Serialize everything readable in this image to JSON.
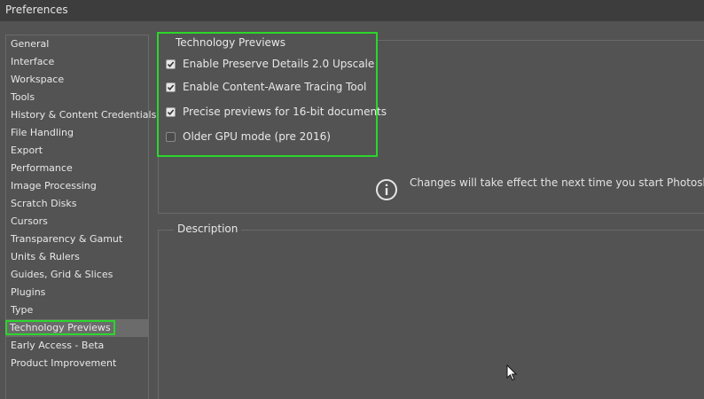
{
  "window": {
    "title": "Preferences"
  },
  "sidebar": {
    "items": [
      {
        "label": "General"
      },
      {
        "label": "Interface"
      },
      {
        "label": "Workspace"
      },
      {
        "label": "Tools"
      },
      {
        "label": "History & Content Credentials"
      },
      {
        "label": "File Handling"
      },
      {
        "label": "Export"
      },
      {
        "label": "Performance"
      },
      {
        "label": "Image Processing"
      },
      {
        "label": "Scratch Disks"
      },
      {
        "label": "Cursors"
      },
      {
        "label": "Transparency & Gamut"
      },
      {
        "label": "Units & Rulers"
      },
      {
        "label": "Guides, Grid & Slices"
      },
      {
        "label": "Plugins"
      },
      {
        "label": "Type"
      },
      {
        "label": "Technology Previews",
        "selected": true
      },
      {
        "label": "Early Access - Beta"
      },
      {
        "label": "Product Improvement"
      }
    ]
  },
  "technology_previews": {
    "legend": "Technology Previews",
    "options": [
      {
        "label": "Enable Preserve Details 2.0 Upscale",
        "checked": true
      },
      {
        "label": "Enable Content-Aware Tracing Tool",
        "checked": true
      },
      {
        "label": "Precise previews for 16-bit documents",
        "checked": true
      },
      {
        "label": "Older GPU mode (pre 2016)",
        "checked": false
      }
    ]
  },
  "notice": {
    "icon": "info-icon",
    "text": "Changes will take effect the next time you start Photoshop."
  },
  "description": {
    "legend": "Description"
  },
  "colors": {
    "highlight": "#2bd62b",
    "background": "#535353",
    "titlebar": "#3d3d3d",
    "selected_row": "#6b6b6b"
  }
}
